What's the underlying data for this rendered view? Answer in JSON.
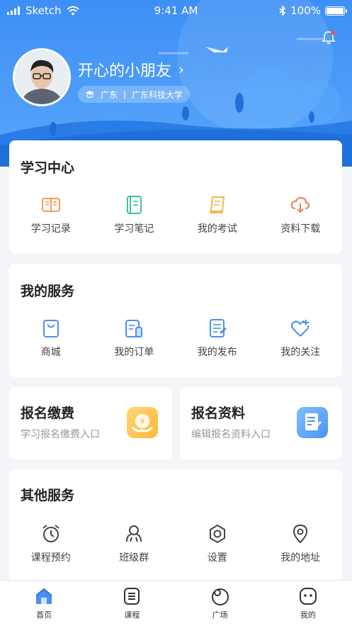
{
  "status_bar": {
    "carrier": "Sketch",
    "time": "9:41 AM",
    "battery": "100%",
    "battery_level": 1.0
  },
  "profile": {
    "name": "开心的小朋友",
    "province": "广东",
    "school": "广东科技大学"
  },
  "study_center": {
    "title": "学习中心",
    "items": [
      {
        "label": "学习记录",
        "icon": "book-open-icon",
        "color": "#f59a57"
      },
      {
        "label": "学习笔记",
        "icon": "notebook-icon",
        "color": "#3cc49a"
      },
      {
        "label": "我的考试",
        "icon": "exam-scroll-icon",
        "color": "#f5b84a"
      },
      {
        "label": "资料下载",
        "icon": "cloud-download-icon",
        "color": "#f27d54"
      }
    ]
  },
  "my_services": {
    "title": "我的服务",
    "items": [
      {
        "label": "商城",
        "icon": "shopping-bag-icon",
        "color": "#4a90f0"
      },
      {
        "label": "我的订单",
        "icon": "order-icon",
        "color": "#4a90f0"
      },
      {
        "label": "我的发布",
        "icon": "publish-icon",
        "color": "#4a90f0"
      },
      {
        "label": "我的关注",
        "icon": "heart-plus-icon",
        "color": "#4a90f0"
      }
    ]
  },
  "registration": {
    "pay": {
      "title": "报名缴费",
      "subtitle": "学习报名缴费入口",
      "icon": "payment-icon"
    },
    "info": {
      "title": "报名资料",
      "subtitle": "编辑报名资料入口",
      "icon": "edit-document-icon"
    }
  },
  "other_services": {
    "title": "其他服务",
    "items": [
      {
        "label": "课程预约",
        "icon": "alarm-clock-icon"
      },
      {
        "label": "班级群",
        "icon": "group-icon"
      },
      {
        "label": "设置",
        "icon": "settings-icon"
      },
      {
        "label": "我的地址",
        "icon": "location-pin-icon"
      }
    ]
  },
  "tabbar": {
    "items": [
      {
        "label": "首页",
        "icon": "home-icon",
        "active": true
      },
      {
        "label": "课程",
        "icon": "course-list-icon",
        "active": false
      },
      {
        "label": "广场",
        "icon": "plaza-icon",
        "active": false
      },
      {
        "label": "我的",
        "icon": "profile-face-icon",
        "active": false
      }
    ]
  },
  "colors": {
    "primary": "#4a90f0",
    "header_top": "#3d8ff5",
    "background": "#f3f5f8"
  }
}
